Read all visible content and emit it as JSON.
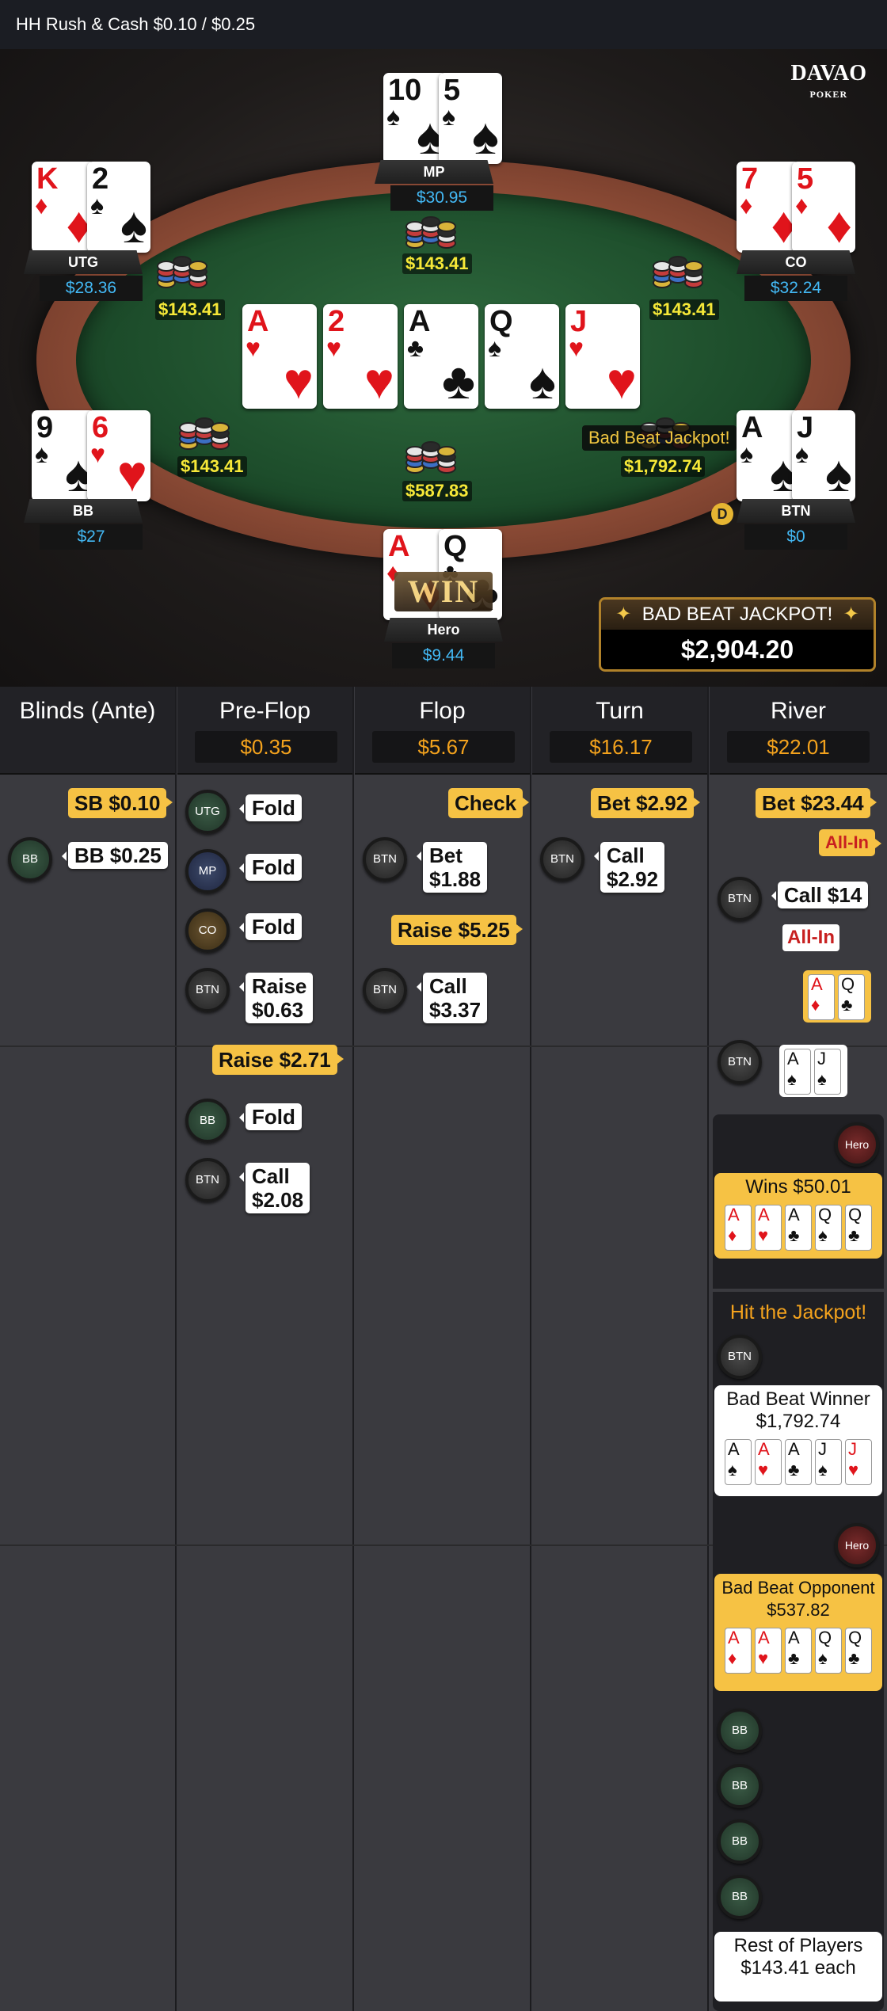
{
  "header": {
    "title": "HH  Rush & Cash $0.10 / $0.25"
  },
  "logo": {
    "brand": "DAVAO",
    "sub": "POKER"
  },
  "seats": {
    "mp": {
      "name": "MP",
      "stack": "$30.95",
      "cards": [
        {
          "r": "10",
          "s": "♠",
          "c": "blk"
        },
        {
          "r": "5",
          "s": "♠",
          "c": "blk"
        }
      ]
    },
    "utg": {
      "name": "UTG",
      "stack": "$28.36",
      "cards": [
        {
          "r": "K",
          "s": "♦",
          "c": "red"
        },
        {
          "r": "2",
          "s": "♠",
          "c": "blk"
        }
      ]
    },
    "co": {
      "name": "CO",
      "stack": "$32.24",
      "cards": [
        {
          "r": "7",
          "s": "♦",
          "c": "red"
        },
        {
          "r": "5",
          "s": "♦",
          "c": "red"
        }
      ]
    },
    "bb": {
      "name": "BB",
      "stack": "$27",
      "cards": [
        {
          "r": "9",
          "s": "♠",
          "c": "blk"
        },
        {
          "r": "6",
          "s": "♥",
          "c": "red"
        }
      ]
    },
    "btn": {
      "name": "BTN",
      "stack": "$0",
      "cards": [
        {
          "r": "A",
          "s": "♠",
          "c": "blk"
        },
        {
          "r": "J",
          "s": "♠",
          "c": "blk"
        }
      ]
    },
    "hero": {
      "name": "Hero",
      "stack": "$9.44",
      "cards": [
        {
          "r": "A",
          "s": "♦",
          "c": "red"
        },
        {
          "r": "Q",
          "s": "♣",
          "c": "blk"
        }
      ]
    }
  },
  "board": [
    {
      "r": "A",
      "s": "♥",
      "c": "red"
    },
    {
      "r": "2",
      "s": "♥",
      "c": "red"
    },
    {
      "r": "A",
      "s": "♣",
      "c": "blk"
    },
    {
      "r": "Q",
      "s": "♠",
      "c": "blk"
    },
    {
      "r": "J",
      "s": "♥",
      "c": "red"
    }
  ],
  "bets": {
    "mp": "$143.41",
    "utg": "$143.41",
    "co": "$143.41",
    "bb": "$143.41",
    "btn": "$1,792.74",
    "pot": "$587.83"
  },
  "table": {
    "jackpot_bubble": "Bad Beat Jackpot!",
    "dealer": "D",
    "win": "WIN",
    "jackpot_title": "BAD BEAT JACKPOT!",
    "jackpot_amount": "$2,904.20"
  },
  "columns": [
    {
      "name": "Blinds (Ante)",
      "pot": ""
    },
    {
      "name": "Pre-Flop",
      "pot": "$0.35"
    },
    {
      "name": "Flop",
      "pot": "$5.67"
    },
    {
      "name": "Turn",
      "pot": "$16.17"
    },
    {
      "name": "River",
      "pot": "$22.01"
    }
  ],
  "actions": {
    "blinds": {
      "sb": "SB $0.10",
      "bb": "BB $0.25"
    },
    "preflop": {
      "utg": "Fold",
      "mp": "Fold",
      "co": "Fold",
      "btn_raise": [
        "Raise",
        "$0.63"
      ],
      "hero_raise": "Raise $2.71",
      "bb": "Fold",
      "btn_call": [
        "Call",
        "$2.08"
      ]
    },
    "flop": {
      "hero": "Check",
      "btn_bet": [
        "Bet",
        "$1.88"
      ],
      "hero_raise": "Raise $5.25",
      "btn_call": [
        "Call",
        "$3.37"
      ]
    },
    "turn": {
      "hero": "Bet $2.92",
      "btn_call": [
        "Call",
        "$2.92"
      ]
    },
    "river": {
      "hero": "Bet $23.44",
      "hero_allin": "All-In",
      "btn_call": "Call $14",
      "btn_allin": "All-In",
      "hero_show": [
        {
          "r": "A",
          "s": "♦",
          "c": "red"
        },
        {
          "r": "Q",
          "s": "♣",
          "c": "blk"
        }
      ],
      "btn_show": [
        {
          "r": "A",
          "s": "♠",
          "c": "blk"
        },
        {
          "r": "J",
          "s": "♠",
          "c": "blk"
        }
      ]
    }
  },
  "results": {
    "win_title": "Wins $50.01",
    "win_cards": [
      {
        "r": "A",
        "s": "♦",
        "c": "red"
      },
      {
        "r": "A",
        "s": "♥",
        "c": "red"
      },
      {
        "r": "A",
        "s": "♣",
        "c": "blk"
      },
      {
        "r": "Q",
        "s": "♠",
        "c": "blk"
      },
      {
        "r": "Q",
        "s": "♣",
        "c": "blk"
      }
    ],
    "jackpot_header": "Hit the Jackpot!",
    "winner_title": "Bad Beat Winner",
    "winner_amount": "$1,792.74",
    "winner_cards": [
      {
        "r": "A",
        "s": "♠",
        "c": "blk"
      },
      {
        "r": "A",
        "s": "♥",
        "c": "red"
      },
      {
        "r": "A",
        "s": "♣",
        "c": "blk"
      },
      {
        "r": "J",
        "s": "♠",
        "c": "blk"
      },
      {
        "r": "J",
        "s": "♥",
        "c": "red"
      }
    ],
    "opp_title": "Bad Beat Opponent",
    "opp_amount": "$537.82",
    "opp_cards": [
      {
        "r": "A",
        "s": "♦",
        "c": "red"
      },
      {
        "r": "A",
        "s": "♥",
        "c": "red"
      },
      {
        "r": "A",
        "s": "♣",
        "c": "blk"
      },
      {
        "r": "Q",
        "s": "♠",
        "c": "blk"
      },
      {
        "r": "Q",
        "s": "♣",
        "c": "blk"
      }
    ],
    "rest_title": "Rest of Players",
    "rest_amount": "$143.41 each"
  },
  "chip_labels": {
    "utg": "UTG",
    "mp": "MP",
    "co": "CO",
    "btn": "BTN",
    "bb": "BB",
    "hero": "Hero"
  }
}
